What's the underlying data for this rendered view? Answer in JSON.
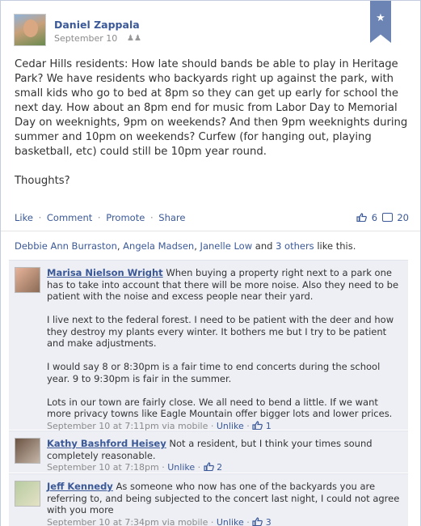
{
  "post": {
    "author": "Daniel Zappala",
    "date": "September 10",
    "body": "Cedar Hills residents: How late should bands be able to play in Heritage Park? We have residents who backyards right up against the park, with small kids who go to bed at 8pm so they can get up early for school the next day. How about an 8pm end for music from Labor Day to Memorial Day on weeknights, 9pm on weekends? And then 9pm weeknights during summer and 10pm on weekends? Curfew (for hanging out, playing basketball, etc) could still be 10pm year round.\n\nThoughts?"
  },
  "actions": {
    "like": "Like",
    "comment": "Comment",
    "promote": "Promote",
    "share": "Share",
    "separator": "·",
    "like_count": "6",
    "comment_count": "20"
  },
  "likes_line": {
    "names": [
      "Debbie Ann Burraston",
      "Angela Madsen",
      "Janelle Low"
    ],
    "connector": "and",
    "others": "3 others",
    "suffix": "like this."
  },
  "comments": [
    {
      "name": "Marisa Nielson Wright",
      "text": "When buying a property right next to a park one has to take into account that there will be more noise. Also they need to be patient with the noise and excess people near their yard.\n\nI live next to the federal forest. I need to be patient with the deer and how they destroy my plants every winter. It bothers me but I try to be patient and make adjustments.\n\nI would say 8 or 8:30pm is a fair time to end concerts during the school year. 9 to 9:30pm is fair in the summer.\n\nLots in our town are fairly close. We all need to bend a little. If we want more privacy towns like Eagle Mountain offer bigger lots and lower prices.",
      "meta": "September 10 at 7:11pm via mobile",
      "unlike": "Unlike",
      "likes": "1"
    },
    {
      "name": "Kathy Bashford Heisey",
      "text": "Not a resident, but I think your times sound completely reasonable.",
      "meta": "September 10 at 7:18pm",
      "unlike": "Unlike",
      "likes": "2"
    },
    {
      "name": "Jeff Kennedy",
      "text": "As someone who now has one of the backyards you are referring to, and being subjected to the concert last night, I could not agree with you more",
      "meta": "September 10 at 7:34pm via mobile",
      "unlike": "Unlike",
      "likes": "3"
    }
  ],
  "icons": {
    "bookmark": "star-icon",
    "audience": "friends-icon",
    "like": "thumbs-up-icon",
    "comment": "comment-bubble-icon"
  },
  "colors": {
    "link": "#3b5998",
    "comment_bg": "#edeff4",
    "bookmark": "#6b84b4"
  }
}
